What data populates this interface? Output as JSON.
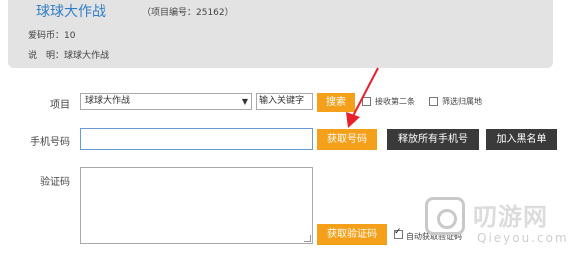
{
  "project_info": {
    "title": "球球大作战",
    "code": "（项目编号：25162）",
    "coins": "爱码币：10",
    "description": "说　明：球球大作战"
  },
  "form": {
    "project": {
      "label": "项目",
      "selected": "球球大作战",
      "keyword_value": "输入关键字",
      "search_button": "搜索",
      "option1": "接收第二条",
      "option2": "筛选归属地"
    },
    "phone": {
      "label": "手机号码",
      "value": "",
      "get_button": "获取号码",
      "release_button": "释放所有手机号",
      "blacklist_button": "加入黑名单"
    },
    "code": {
      "label": "验证码",
      "value": "",
      "get_button": "获取验证码",
      "auto_label": "自动获取验证码"
    }
  },
  "watermark": {
    "text": "叨游网",
    "url": "Qieyou.com"
  },
  "colors": {
    "accent": "#f5a01a",
    "title": "#2f7fc8",
    "annotation_arrow": "#e8202a"
  }
}
